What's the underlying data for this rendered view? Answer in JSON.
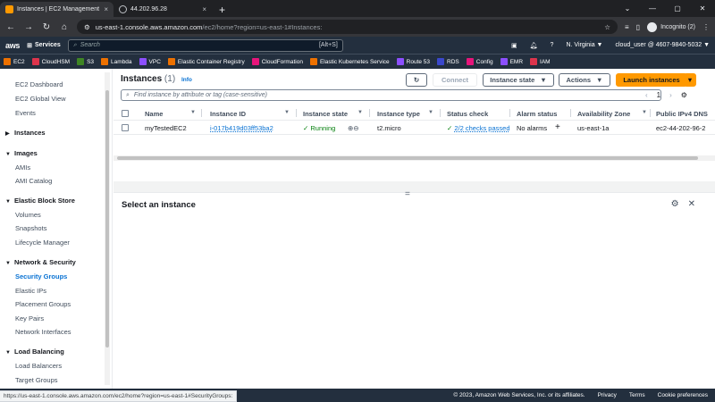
{
  "browser": {
    "tabs": [
      {
        "title": "Instances | EC2 Management Co",
        "close": "×"
      },
      {
        "title": "44.202.96.28",
        "close": "×"
      }
    ],
    "new_tab": "+",
    "url_host": "us-east-1.console.aws.amazon.com",
    "url_rest": "/ec2/home?region=us-east-1#Instances:",
    "incognito_label": "Incognito (2)",
    "hover_url": "https://us-east-1.console.aws.amazon.com/ec2/home?region=us-east-1#SecurityGroups:"
  },
  "aws_nav": {
    "logo": "aws",
    "services": "Services",
    "search_placeholder": "Search",
    "search_shortcut": "[Alt+S]",
    "region": "N. Virginia ▼",
    "account": "cloud_user @ 4607-9840-5032 ▼"
  },
  "favorites": [
    {
      "label": "EC2",
      "color": "#ed7100"
    },
    {
      "label": "CloudHSM",
      "color": "#dd344c"
    },
    {
      "label": "S3",
      "color": "#3f8624"
    },
    {
      "label": "Lambda",
      "color": "#ed7100"
    },
    {
      "label": "VPC",
      "color": "#8c4fff"
    },
    {
      "label": "Elastic Container Registry",
      "color": "#ed7100"
    },
    {
      "label": "CloudFormation",
      "color": "#e7157b"
    },
    {
      "label": "Elastic Kubernetes Service",
      "color": "#ed7100"
    },
    {
      "label": "Route 53",
      "color": "#8c4fff"
    },
    {
      "label": "RDS",
      "color": "#3b48cc"
    },
    {
      "label": "Config",
      "color": "#e7157b"
    },
    {
      "label": "EMR",
      "color": "#8c4fff"
    },
    {
      "label": "IAM",
      "color": "#dd344c"
    }
  ],
  "sidebar": {
    "top": [
      "EC2 Dashboard",
      "EC2 Global View",
      "Events"
    ],
    "sections": [
      {
        "title": "Instances",
        "items": []
      },
      {
        "title": "Images",
        "items": [
          "AMIs",
          "AMI Catalog"
        ]
      },
      {
        "title": "Elastic Block Store",
        "items": [
          "Volumes",
          "Snapshots",
          "Lifecycle Manager"
        ]
      },
      {
        "title": "Network & Security",
        "items": [
          "Security Groups",
          "Elastic IPs",
          "Placement Groups",
          "Key Pairs",
          "Network Interfaces"
        ]
      },
      {
        "title": "Load Balancing",
        "items": [
          "Load Balancers",
          "Target Groups"
        ]
      }
    ],
    "active": "Security Groups"
  },
  "instances": {
    "title": "Instances",
    "count": "(1)",
    "info": "Info",
    "connect": "Connect",
    "instance_state": "Instance state",
    "actions": "Actions",
    "launch": "Launch instances",
    "filter_placeholder": "Find instance by attribute or tag (case-sensitive)",
    "page": "1",
    "columns": [
      "Name",
      "Instance ID",
      "Instance state",
      "Instance type",
      "Status check",
      "Alarm status",
      "Availability Zone",
      "Public IPv4 DNS"
    ],
    "row": {
      "name": "myTestedEC2",
      "id": "i-017b419d03ff53ba2",
      "state": "Running",
      "type": "t2.micro",
      "status": "2/2 checks passed",
      "alarm": "No alarms",
      "az": "us-east-1a",
      "dns": "ec2-44-202-96-2"
    }
  },
  "detail": {
    "heading": "Select an instance"
  },
  "footer": {
    "copyright": "© 2023, Amazon Web Services, Inc. or its affiliates.",
    "privacy": "Privacy",
    "terms": "Terms",
    "cookies": "Cookie preferences"
  }
}
